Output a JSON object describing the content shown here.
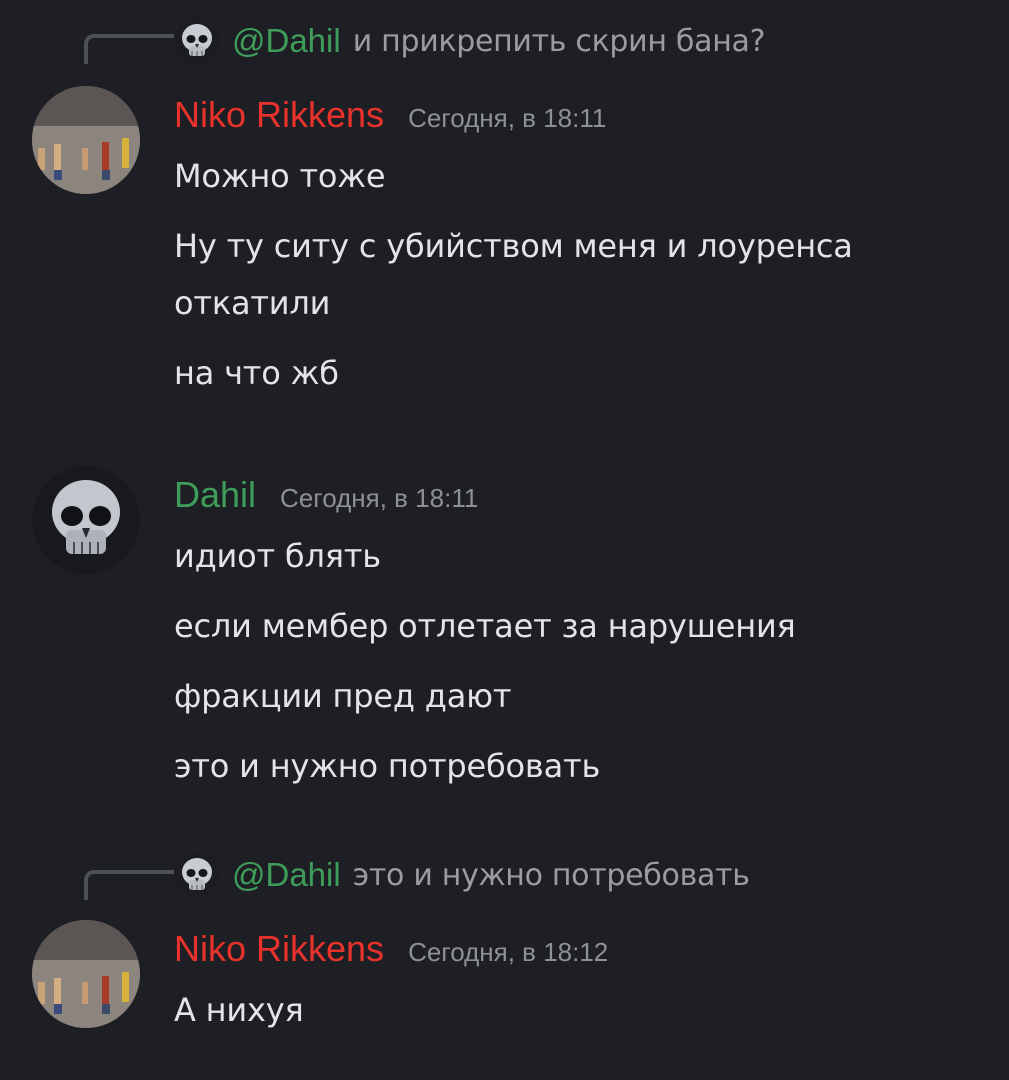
{
  "colors": {
    "background": "#1e1f25",
    "niko_name": "#e8322b",
    "dahil_name": "#3f9d5a",
    "timestamp": "#8e9097",
    "message_text": "#e3e4e8",
    "reply_text": "#9b9ca3"
  },
  "messages": [
    {
      "reply": {
        "mention": "@Dahil",
        "text": "и прикрепить скрин бана?"
      },
      "author": "Niko Rikkens",
      "timestamp": "Сегодня, в 18:11",
      "lines": [
        "Можно тоже",
        "Ну ту ситу с убийством меня и лоуренса",
        "откатили",
        "на что жб"
      ]
    },
    {
      "author": "Dahil",
      "timestamp": "Сегодня, в 18:11",
      "lines": [
        "идиот блять",
        "если мембер отлетает за нарушения",
        "фракции пред дают",
        "это и нужно потребовать"
      ]
    },
    {
      "reply": {
        "mention": "@Dahil",
        "text": "это и нужно потребовать"
      },
      "author": "Niko Rikkens",
      "timestamp": "Сегодня, в 18:12",
      "lines": [
        "А нихуя"
      ]
    }
  ]
}
